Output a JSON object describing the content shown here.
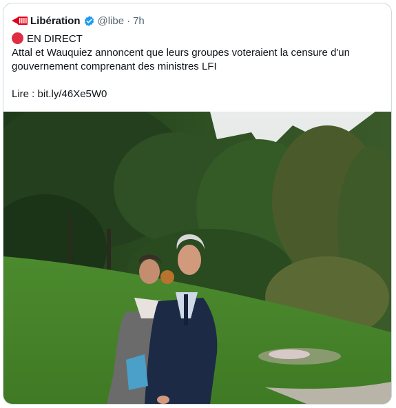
{
  "tweet": {
    "author_name": "Libération",
    "handle": "@libe",
    "separator": "·",
    "time": "7h",
    "live_label": "EN DIRECT",
    "body_line1": "Attal et Wauquiez annoncent que leurs groupes voteraient la censure d'un",
    "body_line2": "gouvernement comprenant des ministres LFI",
    "read_prefix": "Lire : ",
    "link_text": "bit.ly/46Xe5W0"
  },
  "icons": {
    "logo": "liberation-logo-icon",
    "verified": "verified-badge-icon",
    "live": "red-circle-icon"
  },
  "colors": {
    "verified_blue": "#1d9bf0",
    "live_red": "#dd2e44",
    "muted_text": "#536471",
    "border": "#cfd9de"
  },
  "photo": {
    "alt": "Two men in suits walking on a lawn in front of trees"
  }
}
